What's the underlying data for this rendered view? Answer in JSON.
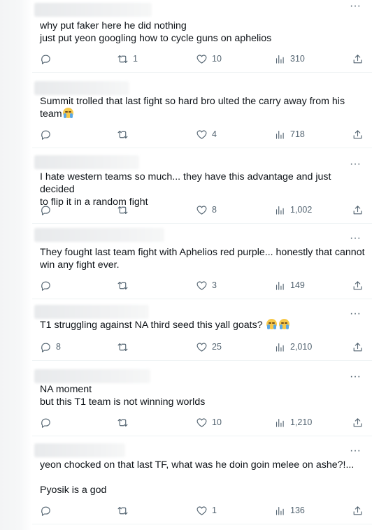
{
  "posts": [
    {
      "text": "why put faker here he did nothing\njust put yeon googling how to cycle guns on aphelios",
      "emoji_count": 0,
      "replies": "",
      "reposts": "1",
      "likes": "10",
      "views": "310"
    },
    {
      "text": "Summit trolled that last fight so hard bro ulted the carry away from his\nteam",
      "emoji_count": 1,
      "replies": "",
      "reposts": "",
      "likes": "4",
      "views": "718"
    },
    {
      "text": "I hate western teams so much... they have this advantage and just decided\nto flip it in a random fight",
      "emoji_count": 0,
      "replies": "",
      "reposts": "",
      "likes": "8",
      "views": "1,002"
    },
    {
      "text": "They fought last team fight with Aphelios red purple... honestly that cannot\nwin any fight ever.",
      "emoji_count": 0,
      "replies": "",
      "reposts": "",
      "likes": "3",
      "views": "149"
    },
    {
      "text": "T1 struggling against NA third seed  this yall goats? ",
      "emoji_count": 2,
      "replies": "8",
      "reposts": "",
      "likes": "25",
      "views": "2,010"
    },
    {
      "text": "NA moment\nbut this T1 team is not winning worlds",
      "emoji_count": 0,
      "replies": "",
      "reposts": "",
      "likes": "10",
      "views": "1,210"
    },
    {
      "text": "yeon chocked on that last TF, what was he doin goin melee on ashe?!...\n\nPyosik is a god",
      "emoji_count": 0,
      "replies": "",
      "reposts": "",
      "likes": "1",
      "views": "136"
    }
  ],
  "icons": {
    "reply": "reply-icon",
    "repost": "repost-icon",
    "like": "heart-icon",
    "views": "views-icon",
    "share": "share-icon",
    "more": "more-icon",
    "emoji": "loudly-crying-face-emoji"
  },
  "colors": {
    "text": "#0f1419",
    "secondary": "#536471",
    "divider": "#eff3f4"
  }
}
